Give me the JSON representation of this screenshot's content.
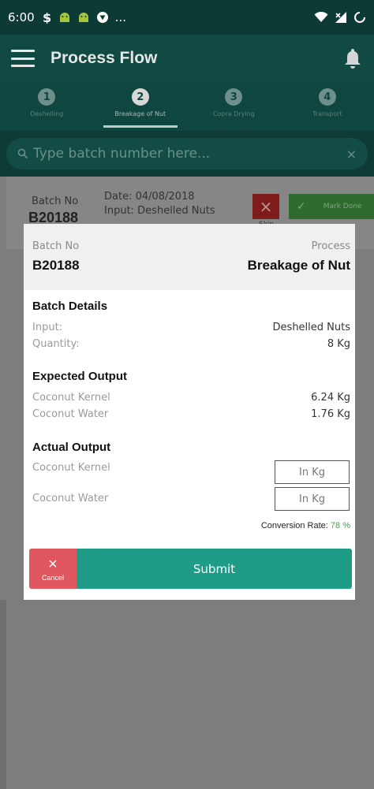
{
  "status_bar": {
    "time": "6:00",
    "more": "..."
  },
  "app_bar": {
    "title": "Process Flow"
  },
  "stepper": {
    "steps": [
      {
        "number": "1",
        "label": "Deshelling"
      },
      {
        "number": "2",
        "label": "Breakage of Nut"
      },
      {
        "number": "3",
        "label": "Copra Drying"
      },
      {
        "number": "4",
        "label": "Transport"
      }
    ],
    "active_index": 1
  },
  "search": {
    "placeholder": "Type batch number here...",
    "clear": "×"
  },
  "batch_card": {
    "batch_no_label": "Batch No",
    "batch_no": "B20188",
    "date": "Date: 04/08/2018",
    "input": "Input: Deshelled Nuts",
    "skip_icon": "×",
    "skip_label": "Skip",
    "mark_done_icon": "✓",
    "mark_done_label": "Mark Done"
  },
  "dialog": {
    "batch_no_label": "Batch No",
    "batch_no": "B20188",
    "process_label": "Process",
    "process": "Breakage of Nut",
    "batch_details": {
      "title": "Batch Details",
      "input_label": "Input:",
      "input_value": "Deshelled Nuts",
      "quantity_label": "Quantity:",
      "quantity_value": "8 Kg"
    },
    "expected_output": {
      "title": "Expected Output",
      "items": [
        {
          "label": "Coconut Kernel",
          "value": "6.24 Kg"
        },
        {
          "label": "Coconut Water",
          "value": "1.76 Kg"
        }
      ]
    },
    "actual_output": {
      "title": "Actual Output",
      "items": [
        {
          "label": "Coconut Kernel",
          "placeholder": "In Kg"
        },
        {
          "label": "Coconut Water",
          "placeholder": "In Kg"
        }
      ]
    },
    "conversion": {
      "label": "Conversion Rate:",
      "value": "78 %"
    },
    "cancel": {
      "icon": "×",
      "label": "Cancel"
    },
    "submit_label": "Submit"
  },
  "colors": {
    "primary_dark": "#0e3a35",
    "primary": "#114a43",
    "accent_teal": "#1f9c88",
    "cancel_red": "#e0575f",
    "conversion_green": "#41a34a"
  }
}
